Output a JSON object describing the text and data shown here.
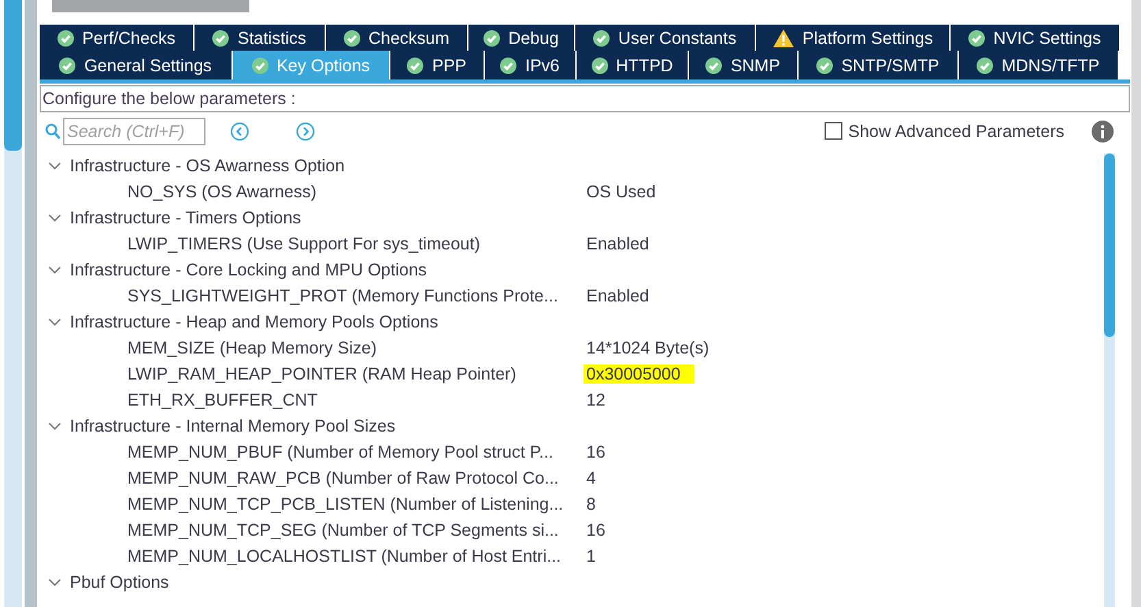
{
  "tab_rows": [
    [
      {
        "label": "Perf/Checks",
        "kind": "ok",
        "selected": false
      },
      {
        "label": "Statistics",
        "kind": "ok",
        "selected": false
      },
      {
        "label": "Checksum",
        "kind": "ok",
        "selected": false
      },
      {
        "label": "Debug",
        "kind": "ok",
        "selected": false
      },
      {
        "label": "User Constants",
        "kind": "ok",
        "selected": false
      },
      {
        "label": "Platform Settings",
        "kind": "warning",
        "selected": false
      },
      {
        "label": "NVIC Settings",
        "kind": "ok",
        "selected": false
      }
    ],
    [
      {
        "label": "General Settings",
        "kind": "ok",
        "selected": false
      },
      {
        "label": "Key Options",
        "kind": "ok",
        "selected": true
      },
      {
        "label": "PPP",
        "kind": "ok",
        "selected": false
      },
      {
        "label": "IPv6",
        "kind": "ok",
        "selected": false
      },
      {
        "label": "HTTPD",
        "kind": "ok",
        "selected": false
      },
      {
        "label": "SNMP",
        "kind": "ok",
        "selected": false
      },
      {
        "label": "SNTP/SMTP",
        "kind": "ok",
        "selected": false
      },
      {
        "label": "MDNS/TFTP",
        "kind": "ok",
        "selected": false
      }
    ]
  ],
  "header": "Configure the below parameters :",
  "search": {
    "placeholder": "Search (Ctrl+F)"
  },
  "show_advanced": {
    "label": "Show Advanced Parameters",
    "checked": false
  },
  "groups": [
    {
      "label": "Infrastructure - OS Awarness Option",
      "expanded": true,
      "children": [
        {
          "label": "NO_SYS (OS Awarness)",
          "value": "OS Used",
          "highlighted": false
        }
      ]
    },
    {
      "label": "Infrastructure - Timers Options",
      "expanded": true,
      "children": [
        {
          "label": "LWIP_TIMERS (Use Support For sys_timeout)",
          "value": "Enabled",
          "highlighted": false
        }
      ]
    },
    {
      "label": "Infrastructure - Core Locking and MPU Options",
      "expanded": true,
      "children": [
        {
          "label": "SYS_LIGHTWEIGHT_PROT (Memory Functions Prote...",
          "value": "Enabled",
          "highlighted": false
        }
      ]
    },
    {
      "label": "Infrastructure - Heap and Memory Pools Options",
      "expanded": true,
      "children": [
        {
          "label": "MEM_SIZE (Heap Memory Size)",
          "value": "14*1024 Byte(s)",
          "highlighted": false
        },
        {
          "label": "LWIP_RAM_HEAP_POINTER (RAM Heap Pointer)",
          "value": "0x30005000",
          "highlighted": true
        },
        {
          "label": "ETH_RX_BUFFER_CNT",
          "value": "12",
          "highlighted": false
        }
      ]
    },
    {
      "label": "Infrastructure - Internal Memory Pool Sizes",
      "expanded": true,
      "children": [
        {
          "label": "MEMP_NUM_PBUF (Number of Memory Pool struct P...",
          "value": "16",
          "highlighted": false
        },
        {
          "label": "MEMP_NUM_RAW_PCB (Number of Raw Protocol Co...",
          "value": "4",
          "highlighted": false
        },
        {
          "label": "MEMP_NUM_TCP_PCB_LISTEN (Number of Listening...",
          "value": "8",
          "highlighted": false
        },
        {
          "label": "MEMP_NUM_TCP_SEG (Number of TCP Segments si...",
          "value": "16",
          "highlighted": false
        },
        {
          "label": "MEMP_NUM_LOCALHOSTLIST (Number of Host Entri...",
          "value": "1",
          "highlighted": false
        }
      ]
    },
    {
      "label": "Pbuf Options",
      "expanded": true
    }
  ]
}
